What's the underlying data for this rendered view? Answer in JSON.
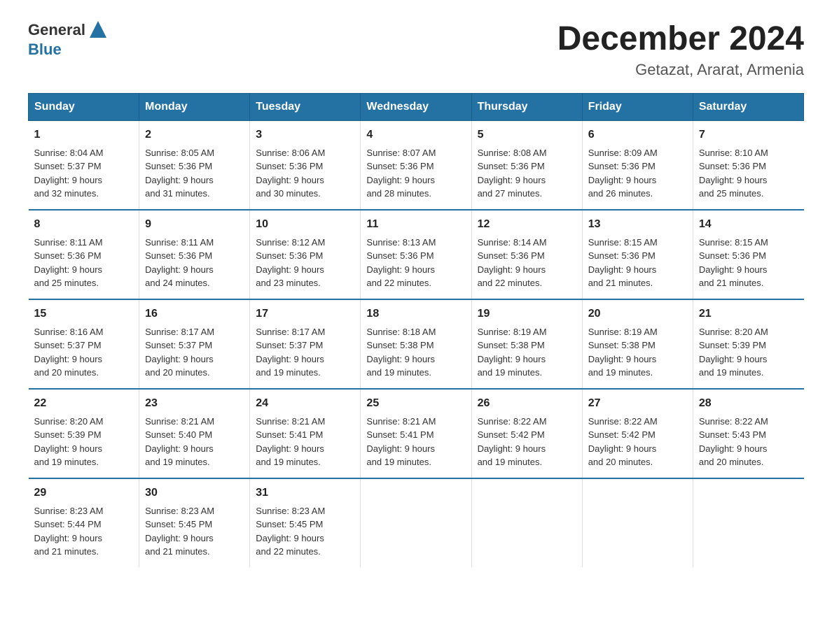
{
  "header": {
    "logo_general": "General",
    "logo_blue": "Blue",
    "month_title": "December 2024",
    "location": "Getazat, Ararat, Armenia"
  },
  "days_of_week": [
    "Sunday",
    "Monday",
    "Tuesday",
    "Wednesday",
    "Thursday",
    "Friday",
    "Saturday"
  ],
  "weeks": [
    [
      {
        "num": "1",
        "sunrise": "8:04 AM",
        "sunset": "5:37 PM",
        "daylight": "9 hours and 32 minutes."
      },
      {
        "num": "2",
        "sunrise": "8:05 AM",
        "sunset": "5:36 PM",
        "daylight": "9 hours and 31 minutes."
      },
      {
        "num": "3",
        "sunrise": "8:06 AM",
        "sunset": "5:36 PM",
        "daylight": "9 hours and 30 minutes."
      },
      {
        "num": "4",
        "sunrise": "8:07 AM",
        "sunset": "5:36 PM",
        "daylight": "9 hours and 28 minutes."
      },
      {
        "num": "5",
        "sunrise": "8:08 AM",
        "sunset": "5:36 PM",
        "daylight": "9 hours and 27 minutes."
      },
      {
        "num": "6",
        "sunrise": "8:09 AM",
        "sunset": "5:36 PM",
        "daylight": "9 hours and 26 minutes."
      },
      {
        "num": "7",
        "sunrise": "8:10 AM",
        "sunset": "5:36 PM",
        "daylight": "9 hours and 25 minutes."
      }
    ],
    [
      {
        "num": "8",
        "sunrise": "8:11 AM",
        "sunset": "5:36 PM",
        "daylight": "9 hours and 25 minutes."
      },
      {
        "num": "9",
        "sunrise": "8:11 AM",
        "sunset": "5:36 PM",
        "daylight": "9 hours and 24 minutes."
      },
      {
        "num": "10",
        "sunrise": "8:12 AM",
        "sunset": "5:36 PM",
        "daylight": "9 hours and 23 minutes."
      },
      {
        "num": "11",
        "sunrise": "8:13 AM",
        "sunset": "5:36 PM",
        "daylight": "9 hours and 22 minutes."
      },
      {
        "num": "12",
        "sunrise": "8:14 AM",
        "sunset": "5:36 PM",
        "daylight": "9 hours and 22 minutes."
      },
      {
        "num": "13",
        "sunrise": "8:15 AM",
        "sunset": "5:36 PM",
        "daylight": "9 hours and 21 minutes."
      },
      {
        "num": "14",
        "sunrise": "8:15 AM",
        "sunset": "5:36 PM",
        "daylight": "9 hours and 21 minutes."
      }
    ],
    [
      {
        "num": "15",
        "sunrise": "8:16 AM",
        "sunset": "5:37 PM",
        "daylight": "9 hours and 20 minutes."
      },
      {
        "num": "16",
        "sunrise": "8:17 AM",
        "sunset": "5:37 PM",
        "daylight": "9 hours and 20 minutes."
      },
      {
        "num": "17",
        "sunrise": "8:17 AM",
        "sunset": "5:37 PM",
        "daylight": "9 hours and 19 minutes."
      },
      {
        "num": "18",
        "sunrise": "8:18 AM",
        "sunset": "5:38 PM",
        "daylight": "9 hours and 19 minutes."
      },
      {
        "num": "19",
        "sunrise": "8:19 AM",
        "sunset": "5:38 PM",
        "daylight": "9 hours and 19 minutes."
      },
      {
        "num": "20",
        "sunrise": "8:19 AM",
        "sunset": "5:38 PM",
        "daylight": "9 hours and 19 minutes."
      },
      {
        "num": "21",
        "sunrise": "8:20 AM",
        "sunset": "5:39 PM",
        "daylight": "9 hours and 19 minutes."
      }
    ],
    [
      {
        "num": "22",
        "sunrise": "8:20 AM",
        "sunset": "5:39 PM",
        "daylight": "9 hours and 19 minutes."
      },
      {
        "num": "23",
        "sunrise": "8:21 AM",
        "sunset": "5:40 PM",
        "daylight": "9 hours and 19 minutes."
      },
      {
        "num": "24",
        "sunrise": "8:21 AM",
        "sunset": "5:41 PM",
        "daylight": "9 hours and 19 minutes."
      },
      {
        "num": "25",
        "sunrise": "8:21 AM",
        "sunset": "5:41 PM",
        "daylight": "9 hours and 19 minutes."
      },
      {
        "num": "26",
        "sunrise": "8:22 AM",
        "sunset": "5:42 PM",
        "daylight": "9 hours and 19 minutes."
      },
      {
        "num": "27",
        "sunrise": "8:22 AM",
        "sunset": "5:42 PM",
        "daylight": "9 hours and 20 minutes."
      },
      {
        "num": "28",
        "sunrise": "8:22 AM",
        "sunset": "5:43 PM",
        "daylight": "9 hours and 20 minutes."
      }
    ],
    [
      {
        "num": "29",
        "sunrise": "8:23 AM",
        "sunset": "5:44 PM",
        "daylight": "9 hours and 21 minutes."
      },
      {
        "num": "30",
        "sunrise": "8:23 AM",
        "sunset": "5:45 PM",
        "daylight": "9 hours and 21 minutes."
      },
      {
        "num": "31",
        "sunrise": "8:23 AM",
        "sunset": "5:45 PM",
        "daylight": "9 hours and 22 minutes."
      },
      null,
      null,
      null,
      null
    ]
  ],
  "labels": {
    "sunrise": "Sunrise:",
    "sunset": "Sunset:",
    "daylight": "Daylight:"
  }
}
